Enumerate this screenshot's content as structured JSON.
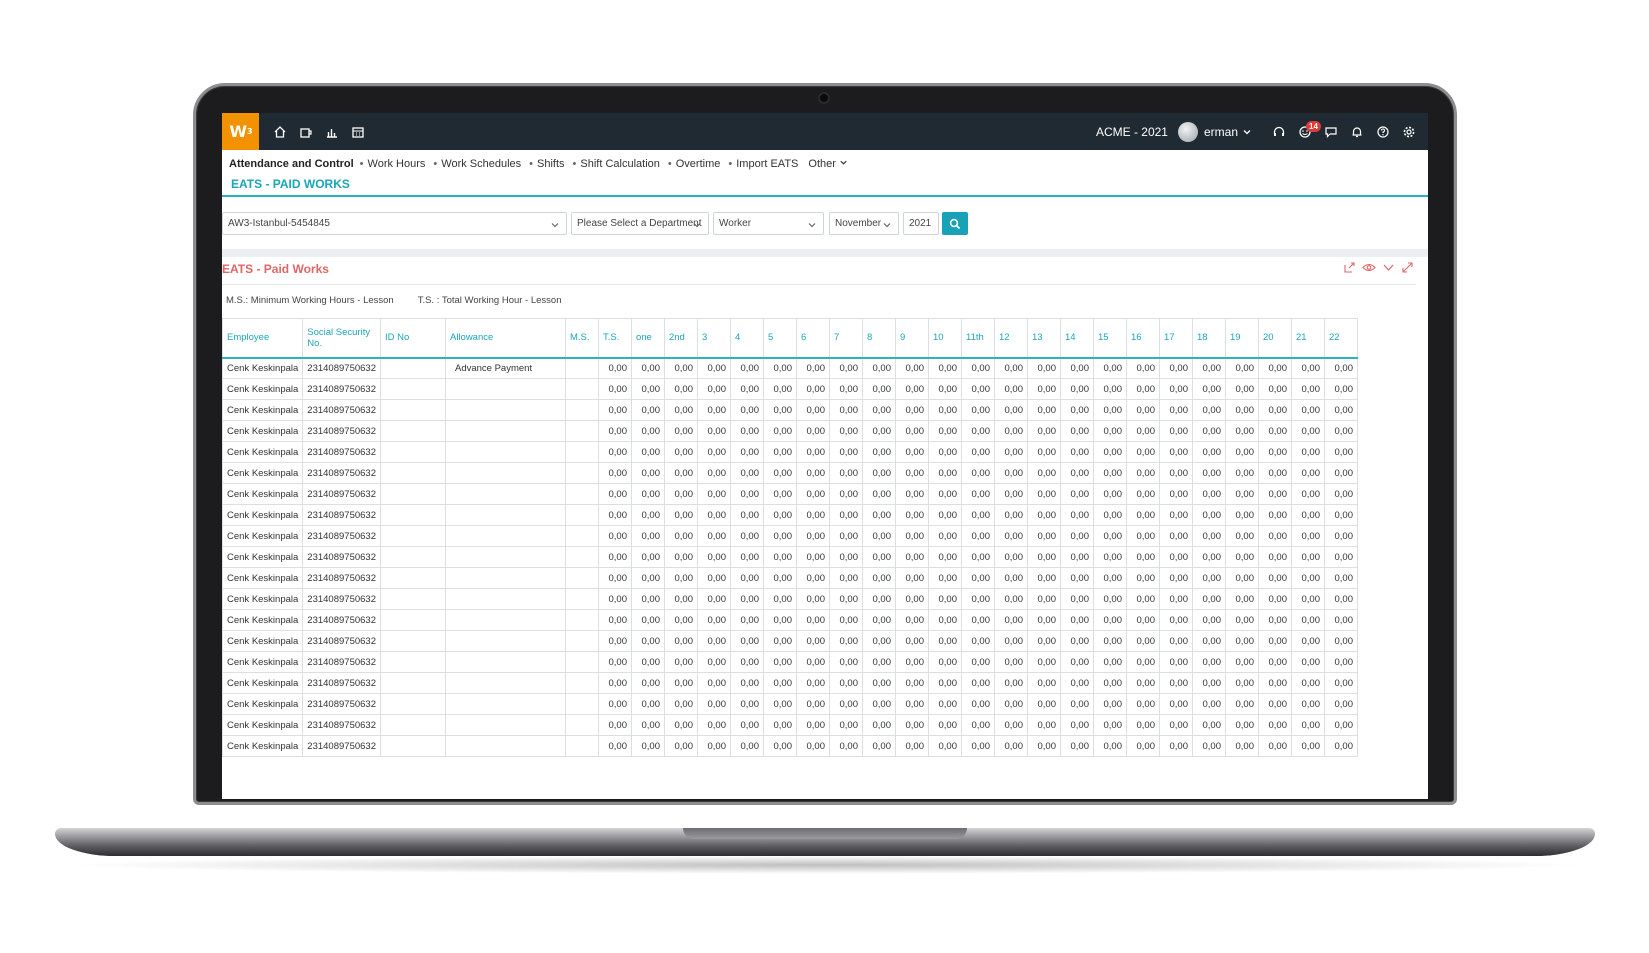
{
  "brand": {
    "logo_text": "W",
    "logo_sup": "3",
    "accent": "#f39200",
    "teal": "#1aa6b7",
    "red_title": "#e06666"
  },
  "topbar": {
    "nav_icons": [
      "home-icon",
      "coffee-icon",
      "bar-chart-icon",
      "calendar-icon"
    ],
    "company": "ACME - 2021",
    "user": "erman",
    "notification_count": "14",
    "right_icons": [
      "headset-icon",
      "smiley-icon",
      "chat-icon",
      "bell-icon",
      "help-icon",
      "gear-icon"
    ]
  },
  "submenu": {
    "crumb": "Attendance and Control",
    "items": [
      "Work Hours",
      "Work Schedules",
      "Shifts",
      "Shift Calculation",
      "Overtime",
      "Import EATS"
    ],
    "other": "Other"
  },
  "page_title": "EATS - PAID WORKS",
  "filters": {
    "branch": "AW3-Istanbul-5454845",
    "department": "Please Select a Department",
    "worker": "Worker",
    "month": "November",
    "year": "2021"
  },
  "panel": {
    "title": "EATS - Paid Works",
    "legend": [
      "M.S.: Minimum Working Hours - Lesson",
      "T.S. : Total Working Hour - Lesson"
    ]
  },
  "table": {
    "headers": [
      "Employee",
      "Social Security No.",
      "ID No",
      "Allowance",
      "M.S.",
      "T.S.",
      "one",
      "2nd",
      "3",
      "4",
      "5",
      "6",
      "7",
      "8",
      "9",
      "10",
      "11th",
      "12",
      "13",
      "14",
      "15",
      "16",
      "17",
      "18",
      "19",
      "20",
      "21",
      "22"
    ],
    "row_employee": "Cenk Keskinpala",
    "row_ssn": "2314089750632",
    "first_row_allowance": "Advance Payment",
    "cell_value": "0,00",
    "row_count": 19
  }
}
